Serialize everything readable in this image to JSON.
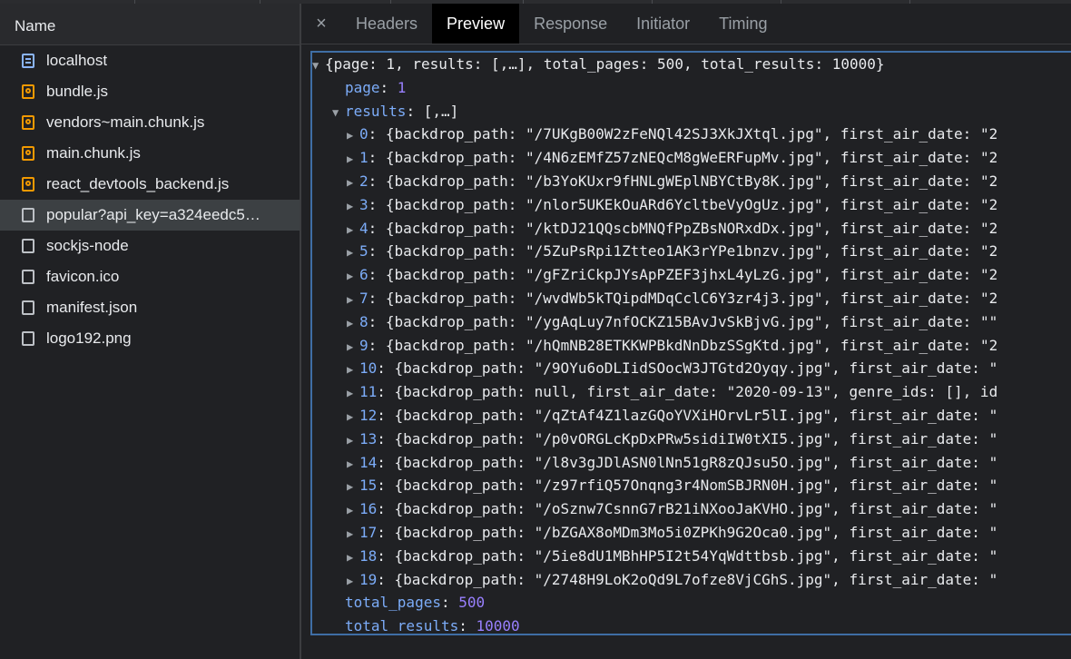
{
  "network": {
    "column_header": "Name",
    "files": [
      {
        "name": "localhost",
        "icon": "document-icon",
        "kind": "doc"
      },
      {
        "name": "bundle.js",
        "icon": "script-icon",
        "kind": "script"
      },
      {
        "name": "vendors~main.chunk.js",
        "icon": "script-icon",
        "kind": "script"
      },
      {
        "name": "main.chunk.js",
        "icon": "script-icon",
        "kind": "script"
      },
      {
        "name": "react_devtools_backend.js",
        "icon": "script-icon",
        "kind": "script"
      },
      {
        "name": "popular?api_key=a324eedc5…",
        "icon": "file-icon",
        "kind": "plain",
        "selected": true
      },
      {
        "name": "sockjs-node",
        "icon": "file-icon",
        "kind": "plain"
      },
      {
        "name": "favicon.ico",
        "icon": "file-icon",
        "kind": "plain"
      },
      {
        "name": "manifest.json",
        "icon": "file-icon",
        "kind": "plain"
      },
      {
        "name": "logo192.png",
        "icon": "file-icon",
        "kind": "plain"
      }
    ]
  },
  "tabs": {
    "close": "×",
    "items": [
      {
        "label": "Headers",
        "active": false
      },
      {
        "label": "Preview",
        "active": true
      },
      {
        "label": "Response",
        "active": false
      },
      {
        "label": "Initiator",
        "active": false
      },
      {
        "label": "Timing",
        "active": false
      }
    ]
  },
  "preview": {
    "summary": "{page: 1, results: [,…], total_pages: 500, total_results: 10000}",
    "page_key": "page",
    "page_value": "1",
    "results_key": "results",
    "results_summary": "[,…]",
    "results": [
      {
        "index": "0",
        "text": "{backdrop_path: \"/7UKgB00W2zFeNQl42SJ3XkJXtql.jpg\", first_air_date: \"2"
      },
      {
        "index": "1",
        "text": "{backdrop_path: \"/4N6zEMfZ57zNEQcM8gWeERFupMv.jpg\", first_air_date: \"2"
      },
      {
        "index": "2",
        "text": "{backdrop_path: \"/b3YoKUxr9fHNLgWEplNBYCtBy8K.jpg\", first_air_date: \"2"
      },
      {
        "index": "3",
        "text": "{backdrop_path: \"/nlor5UKEkOuARd6YcltbeVyOgUz.jpg\", first_air_date: \"2"
      },
      {
        "index": "4",
        "text": "{backdrop_path: \"/ktDJ21QQscbMNQfPpZBsNORxdDx.jpg\", first_air_date: \"2"
      },
      {
        "index": "5",
        "text": "{backdrop_path: \"/5ZuPsRpi1Ztteo1AK3rYPe1bnzv.jpg\", first_air_date: \"2"
      },
      {
        "index": "6",
        "text": "{backdrop_path: \"/gFZriCkpJYsApPZEF3jhxL4yLzG.jpg\", first_air_date: \"2"
      },
      {
        "index": "7",
        "text": "{backdrop_path: \"/wvdWb5kTQipdMDqCclC6Y3zr4j3.jpg\", first_air_date: \"2"
      },
      {
        "index": "8",
        "text": "{backdrop_path: \"/ygAqLuy7nfOCKZ15BAvJvSkBjvG.jpg\", first_air_date: \"\""
      },
      {
        "index": "9",
        "text": "{backdrop_path: \"/hQmNB28ETKKWPBkdNnDbzSSgKtd.jpg\", first_air_date: \"2"
      },
      {
        "index": "10",
        "text": "{backdrop_path: \"/9OYu6oDLIidSOocW3JTGtd2Oyqy.jpg\", first_air_date: \""
      },
      {
        "index": "11",
        "text": "{backdrop_path: null, first_air_date: \"2020-09-13\", genre_ids: [], id"
      },
      {
        "index": "12",
        "text": "{backdrop_path: \"/qZtAf4Z1lazGQoYVXiHOrvLr5lI.jpg\", first_air_date: \""
      },
      {
        "index": "13",
        "text": "{backdrop_path: \"/p0vORGLcKpDxPRw5sidiIW0tXI5.jpg\", first_air_date: \""
      },
      {
        "index": "14",
        "text": "{backdrop_path: \"/l8v3gJDlASN0lNn51gR8zQJsu5O.jpg\", first_air_date: \""
      },
      {
        "index": "15",
        "text": "{backdrop_path: \"/z97rfiQ57Onqng3r4NomSBJRN0H.jpg\", first_air_date: \""
      },
      {
        "index": "16",
        "text": "{backdrop_path: \"/oSznw7CsnnG7rB21iNXooJaKVHO.jpg\", first_air_date: \""
      },
      {
        "index": "17",
        "text": "{backdrop_path: \"/bZGAX8oMDm3Mo5i0ZPKh9G2Oca0.jpg\", first_air_date: \""
      },
      {
        "index": "18",
        "text": "{backdrop_path: \"/5ie8dU1MBhHP5I2t54YqWdttbsb.jpg\", first_air_date: \""
      },
      {
        "index": "19",
        "text": "{backdrop_path: \"/2748H9LoK2oQd9L7ofze8VjCGhS.jpg\", first_air_date: \""
      }
    ],
    "total_pages_key": "total_pages",
    "total_pages_value": "500",
    "total_results_key": "total_results",
    "total_results_value": "10000"
  },
  "colors": {
    "accent": "#3f6ea5",
    "key": "#7cacf8",
    "number": "#9980ff"
  }
}
